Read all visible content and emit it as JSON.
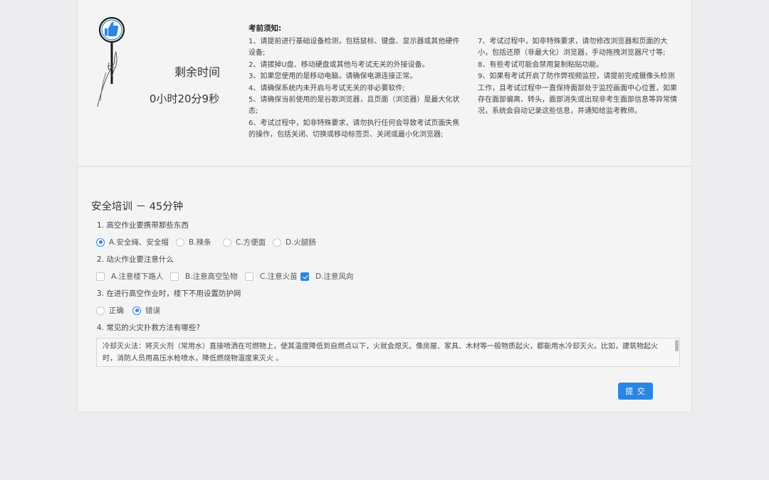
{
  "timer": {
    "label": "剩余时间",
    "value": "0小时20分9秒"
  },
  "notice": {
    "title": "考前须知:",
    "left_items": [
      "1、请提前进行基础设备检测，包括鼠标、键盘、显示器或其他硬件设备;",
      "2、请拔掉U盘、移动硬盘或其他与考试无关的外接设备。",
      "3、如果您使用的是移动电脑，请确保电源连接正常。",
      "4、请确保系统内未开启与考试无关的非必要软件;",
      "5、请确保当前使用的是谷歌浏览器，且页面（浏览器）是最大化状态;",
      "6、考试过程中，如非特殊要求，请勿执行任何会导致考试页面失焦的操作，包括关闭、切换或移动标签页、关闭或最小化浏览器;"
    ],
    "right_items": [
      "7、考试过程中，如非特殊要求，请勿修改浏览器和页面的大小，包括还原（非最大化）浏览器，手动拖拽浏览器尺寸等;",
      "8、有些考试可能会禁用复制粘贴功能。",
      "9、如果有考试开启了防作弊视频监控，请提前完成摄像头检测工作，且考试过程中一直保持面部处于监控画面中心位置，如果存在面部偏离、转头，面部消失或出现非考生面部信息等异常情况，系统会自动记录这些信息，并通知给监考教师。"
    ]
  },
  "exam": {
    "title": "安全培训 － 45分钟",
    "questions": [
      {
        "text": "1. 高空作业要携带那些东西",
        "type": "radio",
        "options": [
          "A.安全绳、安全帽",
          "B.辣条",
          "C.方便面",
          "D.火腿肠"
        ],
        "selected": [
          0
        ]
      },
      {
        "text": "2. 动火作业要注意什么",
        "type": "checkbox",
        "options": [
          "A.注意楼下路人",
          "B.注意高空坠物",
          "C.注意火苗",
          "D.注意风向"
        ],
        "selected": [
          3
        ]
      },
      {
        "text": "3. 在进行高空作业时，楼下不用设置防护网",
        "type": "radio",
        "options": [
          "正确",
          "错误"
        ],
        "selected": [
          1
        ]
      },
      {
        "text": "4. 常见的火灾扑救方法有哪些?",
        "type": "textarea",
        "answer": "冷却灭火法：将灭火剂（常用水）直接喷洒在可燃物上，使其温度降低到自燃点以下，火就会熄灭。像房屋、家具、木材等一般物质起火，都能用水冷却灭火。比如，建筑物起火时，消防人员用高压水枪喷水，降低燃烧物温度来灭火 。"
      }
    ],
    "submit_label": "提 交"
  },
  "colors": {
    "accent": "#2b86e3",
    "background": "#ededef",
    "card": "#f4f4f5"
  },
  "icons": {
    "illustration": "hand-holding-thumbs-up-sign-icon"
  }
}
